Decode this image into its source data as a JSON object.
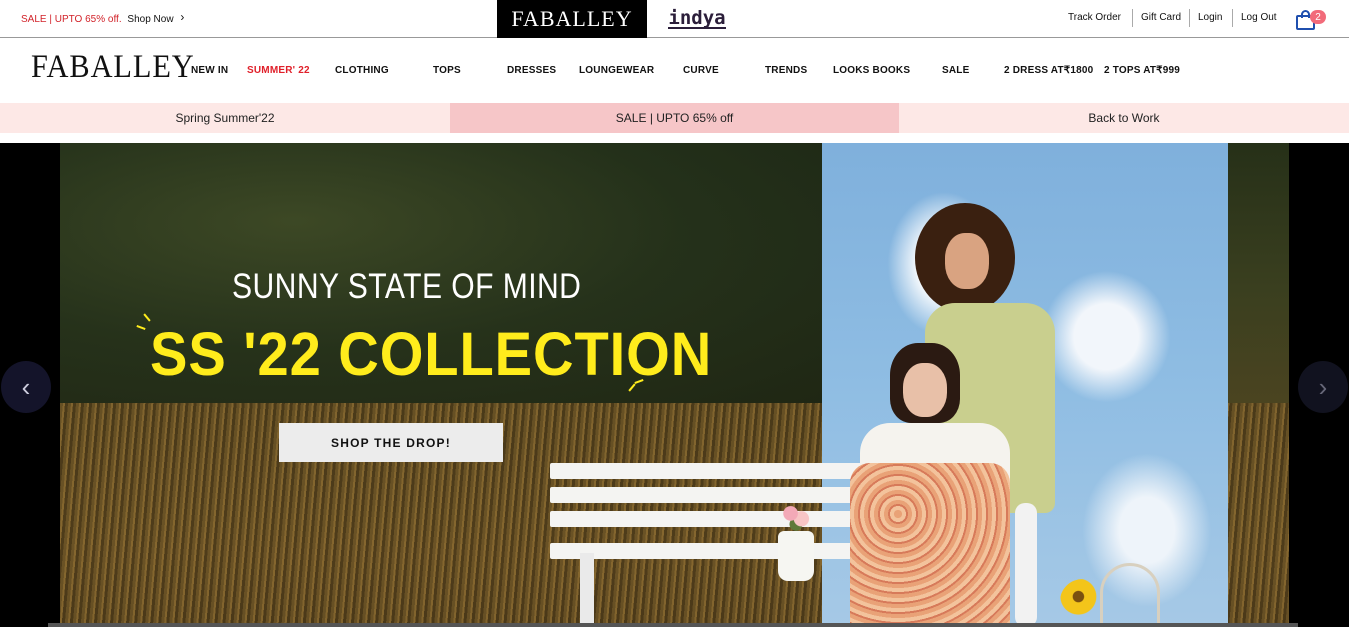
{
  "topbar": {
    "promo_sale": "SALE | UPTO 65% off.",
    "promo_shop": "Shop Now",
    "promo_chevron": "›",
    "brand_primary": "FABALLEY",
    "brand_secondary": "indya",
    "utility_links": [
      "Track Order",
      "Gift Card",
      "Login",
      "Log Out"
    ],
    "cart_count": "2",
    "cart_icon": "shopping-bag-icon"
  },
  "nav": {
    "logo": "FABALLEY",
    "items": [
      {
        "label": "NEW IN",
        "highlight": false
      },
      {
        "label": "SUMMER' 22",
        "highlight": true
      },
      {
        "label": "CLOTHING",
        "highlight": false
      },
      {
        "label": "TOPS",
        "highlight": false
      },
      {
        "label": "DRESSES",
        "highlight": false
      },
      {
        "label": "LOUNGEWEAR",
        "highlight": false
      },
      {
        "label": "CURVE",
        "highlight": false
      },
      {
        "label": "TRENDS",
        "highlight": false
      },
      {
        "label": "LOOKS BOOKS",
        "highlight": false
      },
      {
        "label": "SALE",
        "highlight": false
      },
      {
        "label": "2 DRESS AT₹1800",
        "highlight": false
      },
      {
        "label": "2 TOPS AT₹999",
        "highlight": false
      }
    ],
    "highlight_color": "#e0202a"
  },
  "categories": [
    {
      "label": "Spring Summer'22",
      "active": false
    },
    {
      "label": "SALE | UPTO 65% off",
      "active": true
    },
    {
      "label": "Back to Work",
      "active": false
    }
  ],
  "hero": {
    "subtitle": "SUNNY STATE OF MIND",
    "title": "SS '22 COLLECTION",
    "cta": "SHOP THE DROP!",
    "title_color": "#ffec1c",
    "prev_arrow": "‹",
    "next_arrow": "›"
  }
}
